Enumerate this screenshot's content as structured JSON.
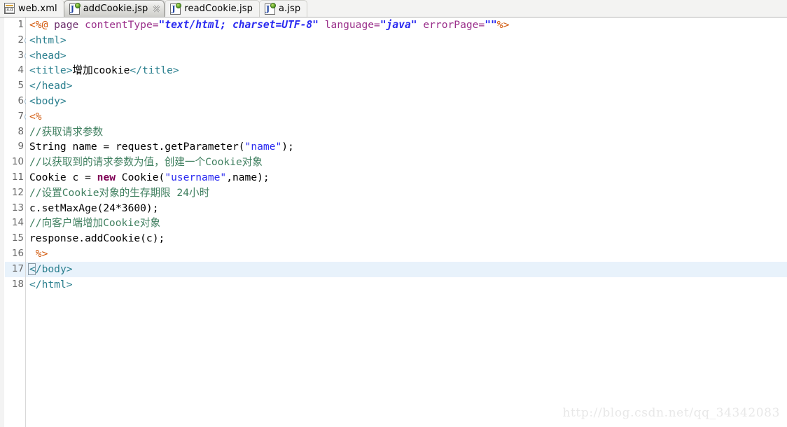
{
  "tabs": [
    {
      "label": "web.xml",
      "icon": "xml-file-icon",
      "active": false,
      "closable": false
    },
    {
      "label": "addCookie.jsp",
      "icon": "jsp-file-icon",
      "active": true,
      "closable": true
    },
    {
      "label": "readCookie.jsp",
      "icon": "jsp-file-icon",
      "active": false,
      "closable": false
    },
    {
      "label": "a.jsp",
      "icon": "jsp-file-icon",
      "active": false,
      "closable": false
    }
  ],
  "editor": {
    "current_line": 17,
    "lines": [
      {
        "n": "1",
        "fold": false,
        "highlight": false,
        "text": "<%@ page contentType=\"text/html; charset=UTF-8\" language=\"java\" errorPage=\"\"%>"
      },
      {
        "n": "2",
        "fold": true,
        "highlight": false,
        "text": "<html>"
      },
      {
        "n": "3",
        "fold": true,
        "highlight": false,
        "text": "<head>"
      },
      {
        "n": "4",
        "fold": false,
        "highlight": false,
        "text": "<title>增加cookie</title>"
      },
      {
        "n": "5",
        "fold": false,
        "highlight": false,
        "text": "</head>"
      },
      {
        "n": "6",
        "fold": true,
        "highlight": false,
        "text": "<body>"
      },
      {
        "n": "7",
        "fold": true,
        "highlight": false,
        "text": "<%"
      },
      {
        "n": "8",
        "fold": false,
        "highlight": false,
        "text": "//获取请求参数"
      },
      {
        "n": "9",
        "fold": false,
        "highlight": false,
        "text": "String name = request.getParameter(\"name\");"
      },
      {
        "n": "10",
        "fold": false,
        "highlight": false,
        "text": "//以获取到的请求参数为值，创建一个Cookie对象"
      },
      {
        "n": "11",
        "fold": false,
        "highlight": false,
        "text": "Cookie c = new Cookie(\"username\",name);"
      },
      {
        "n": "12",
        "fold": false,
        "highlight": false,
        "text": "//设置Cookie对象的生存期限 24小时"
      },
      {
        "n": "13",
        "fold": false,
        "highlight": false,
        "text": "c.setMaxAge(24*3600);"
      },
      {
        "n": "14",
        "fold": false,
        "highlight": false,
        "text": "//向客户端增加Cookie对象"
      },
      {
        "n": "15",
        "fold": false,
        "highlight": false,
        "text": "response.addCookie(c);"
      },
      {
        "n": "16",
        "fold": false,
        "highlight": false,
        "text": " %>"
      },
      {
        "n": "17",
        "fold": false,
        "highlight": true,
        "text": "</body>"
      },
      {
        "n": "18",
        "fold": false,
        "highlight": false,
        "text": "</html>"
      }
    ]
  },
  "watermark": {
    "text": "http://blog.csdn.net/qq_34342083"
  },
  "colors": {
    "directive": "#d2590c",
    "directive_keyword": "#6b2d6b",
    "attribute": "#9a2f8a",
    "attribute_value": "#2a2af0",
    "html_tag": "#2a7f8e",
    "comment": "#3f7f5f",
    "string": "#2a2af0",
    "keyword": "#7f0055",
    "plain": "#000000",
    "line_highlight": "#e8f2fb",
    "gutter_text": "#666666",
    "watermark": "#e8e8e8"
  }
}
